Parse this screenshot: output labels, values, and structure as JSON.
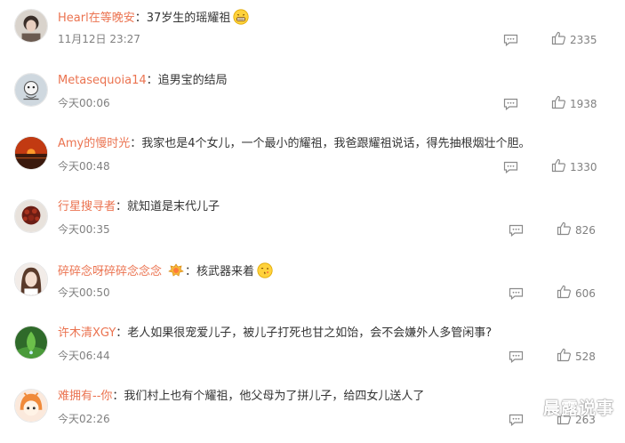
{
  "comments": [
    {
      "username": "Hearl在等晚安",
      "text": "37岁生的瑶耀祖",
      "time": "11月12日 23:27",
      "likes": "2335",
      "emoji": "grin-emoji"
    },
    {
      "username": "Metasequoia14",
      "text": "追男宝的结局",
      "time": "今天00:06",
      "likes": "1938"
    },
    {
      "username": "Amy的慢时光",
      "text": "我家也是4个女儿，一个最小的耀祖，我爸跟耀祖说话，得先抽根烟壮个胆。",
      "time": "今天00:48",
      "likes": "1330"
    },
    {
      "username": "行星搜寻者",
      "text": "就知道是末代儿子",
      "time": "今天00:35",
      "likes": "826"
    },
    {
      "username": "碎碎念呀碎碎念念念",
      "text": "核武器来着",
      "time": "今天00:50",
      "likes": "606",
      "badge": "fan-badge-icon",
      "emoji": "kiss-emoji"
    },
    {
      "username": "许木清XGY",
      "text": "老人如果很宠爱儿子，被儿子打死也甘之如饴，会不会嫌外人多管闲事?",
      "time": "今天06:44",
      "likes": "528"
    },
    {
      "username": "难拥有--你",
      "text": "我们村上也有个耀祖，他父母为了拼儿子，给四女儿送人了",
      "time": "今天02:26",
      "likes": "263"
    }
  ],
  "colon": "：",
  "watermark": "晨露说事",
  "colors": {
    "username": "#eb7350",
    "text": "#333333",
    "meta": "#808080"
  }
}
